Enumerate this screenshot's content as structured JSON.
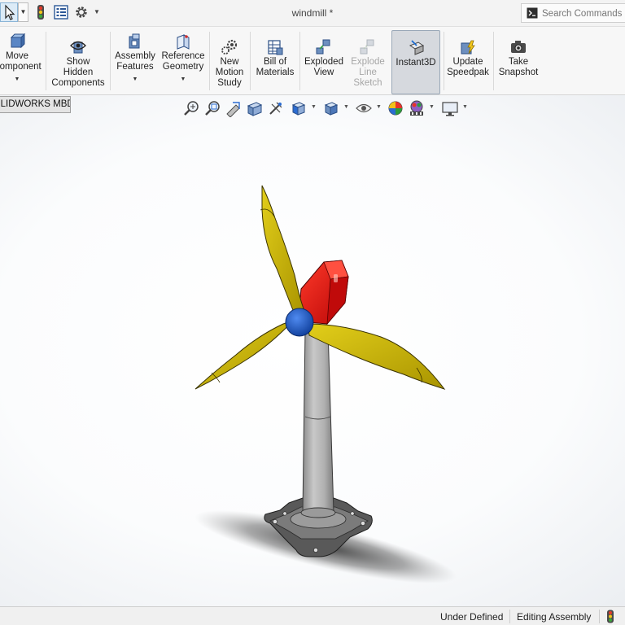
{
  "titlebar": {
    "document_title": "windmill *",
    "search": {
      "placeholder": "Search Commands"
    }
  },
  "ribbon": {
    "buttons": [
      {
        "label": "Move\nComponent",
        "icon": "move-component-icon",
        "has_dropdown": true
      },
      {
        "label": "Show\nHidden\nComponents",
        "icon": "show-hidden-icon",
        "has_dropdown": false
      },
      {
        "label": "Assembly\nFeatures",
        "icon": "assembly-features-icon",
        "has_dropdown": true
      },
      {
        "label": "Reference\nGeometry",
        "icon": "reference-geometry-icon",
        "has_dropdown": true
      },
      {
        "label": "New\nMotion\nStudy",
        "icon": "motion-study-icon",
        "has_dropdown": false
      },
      {
        "label": "Bill of\nMaterials",
        "icon": "bill-of-materials-icon",
        "has_dropdown": false
      },
      {
        "label": "Exploded\nView",
        "icon": "exploded-view-icon",
        "has_dropdown": false
      },
      {
        "label": "Explode\nLine\nSketch",
        "icon": "explode-line-sketch-icon",
        "has_dropdown": false,
        "disabled": true
      },
      {
        "label": "Instant3D",
        "icon": "instant3d-icon",
        "has_dropdown": false,
        "active": true
      },
      {
        "label": "Update\nSpeedpak",
        "icon": "speedpak-icon",
        "has_dropdown": false
      },
      {
        "label": "Take\nSnapshot",
        "icon": "camera-icon",
        "has_dropdown": false
      }
    ]
  },
  "tabs": {
    "mbd": "SOLIDWORKS MBD"
  },
  "heads_up_toolbar": [
    "zoom-to-fit-icon",
    "zoom-to-area-icon",
    "previous-view-icon",
    "section-view-icon",
    "dynamic-annotation-icon",
    "view-orientation-icon",
    "display-style-icon",
    "hide-show-items-icon",
    "edit-appearance-icon",
    "apply-scene-icon",
    "view-settings-icon"
  ],
  "statusbar": {
    "status": "Under Defined",
    "mode": "Editing Assembly"
  },
  "colors": {
    "nacelle": "#e01111",
    "hub": "#1f5fd0",
    "blades": "#c8b400",
    "tower": "#a7a7a7",
    "base": "#6a6a6a",
    "active_button": "#d6d9de"
  }
}
